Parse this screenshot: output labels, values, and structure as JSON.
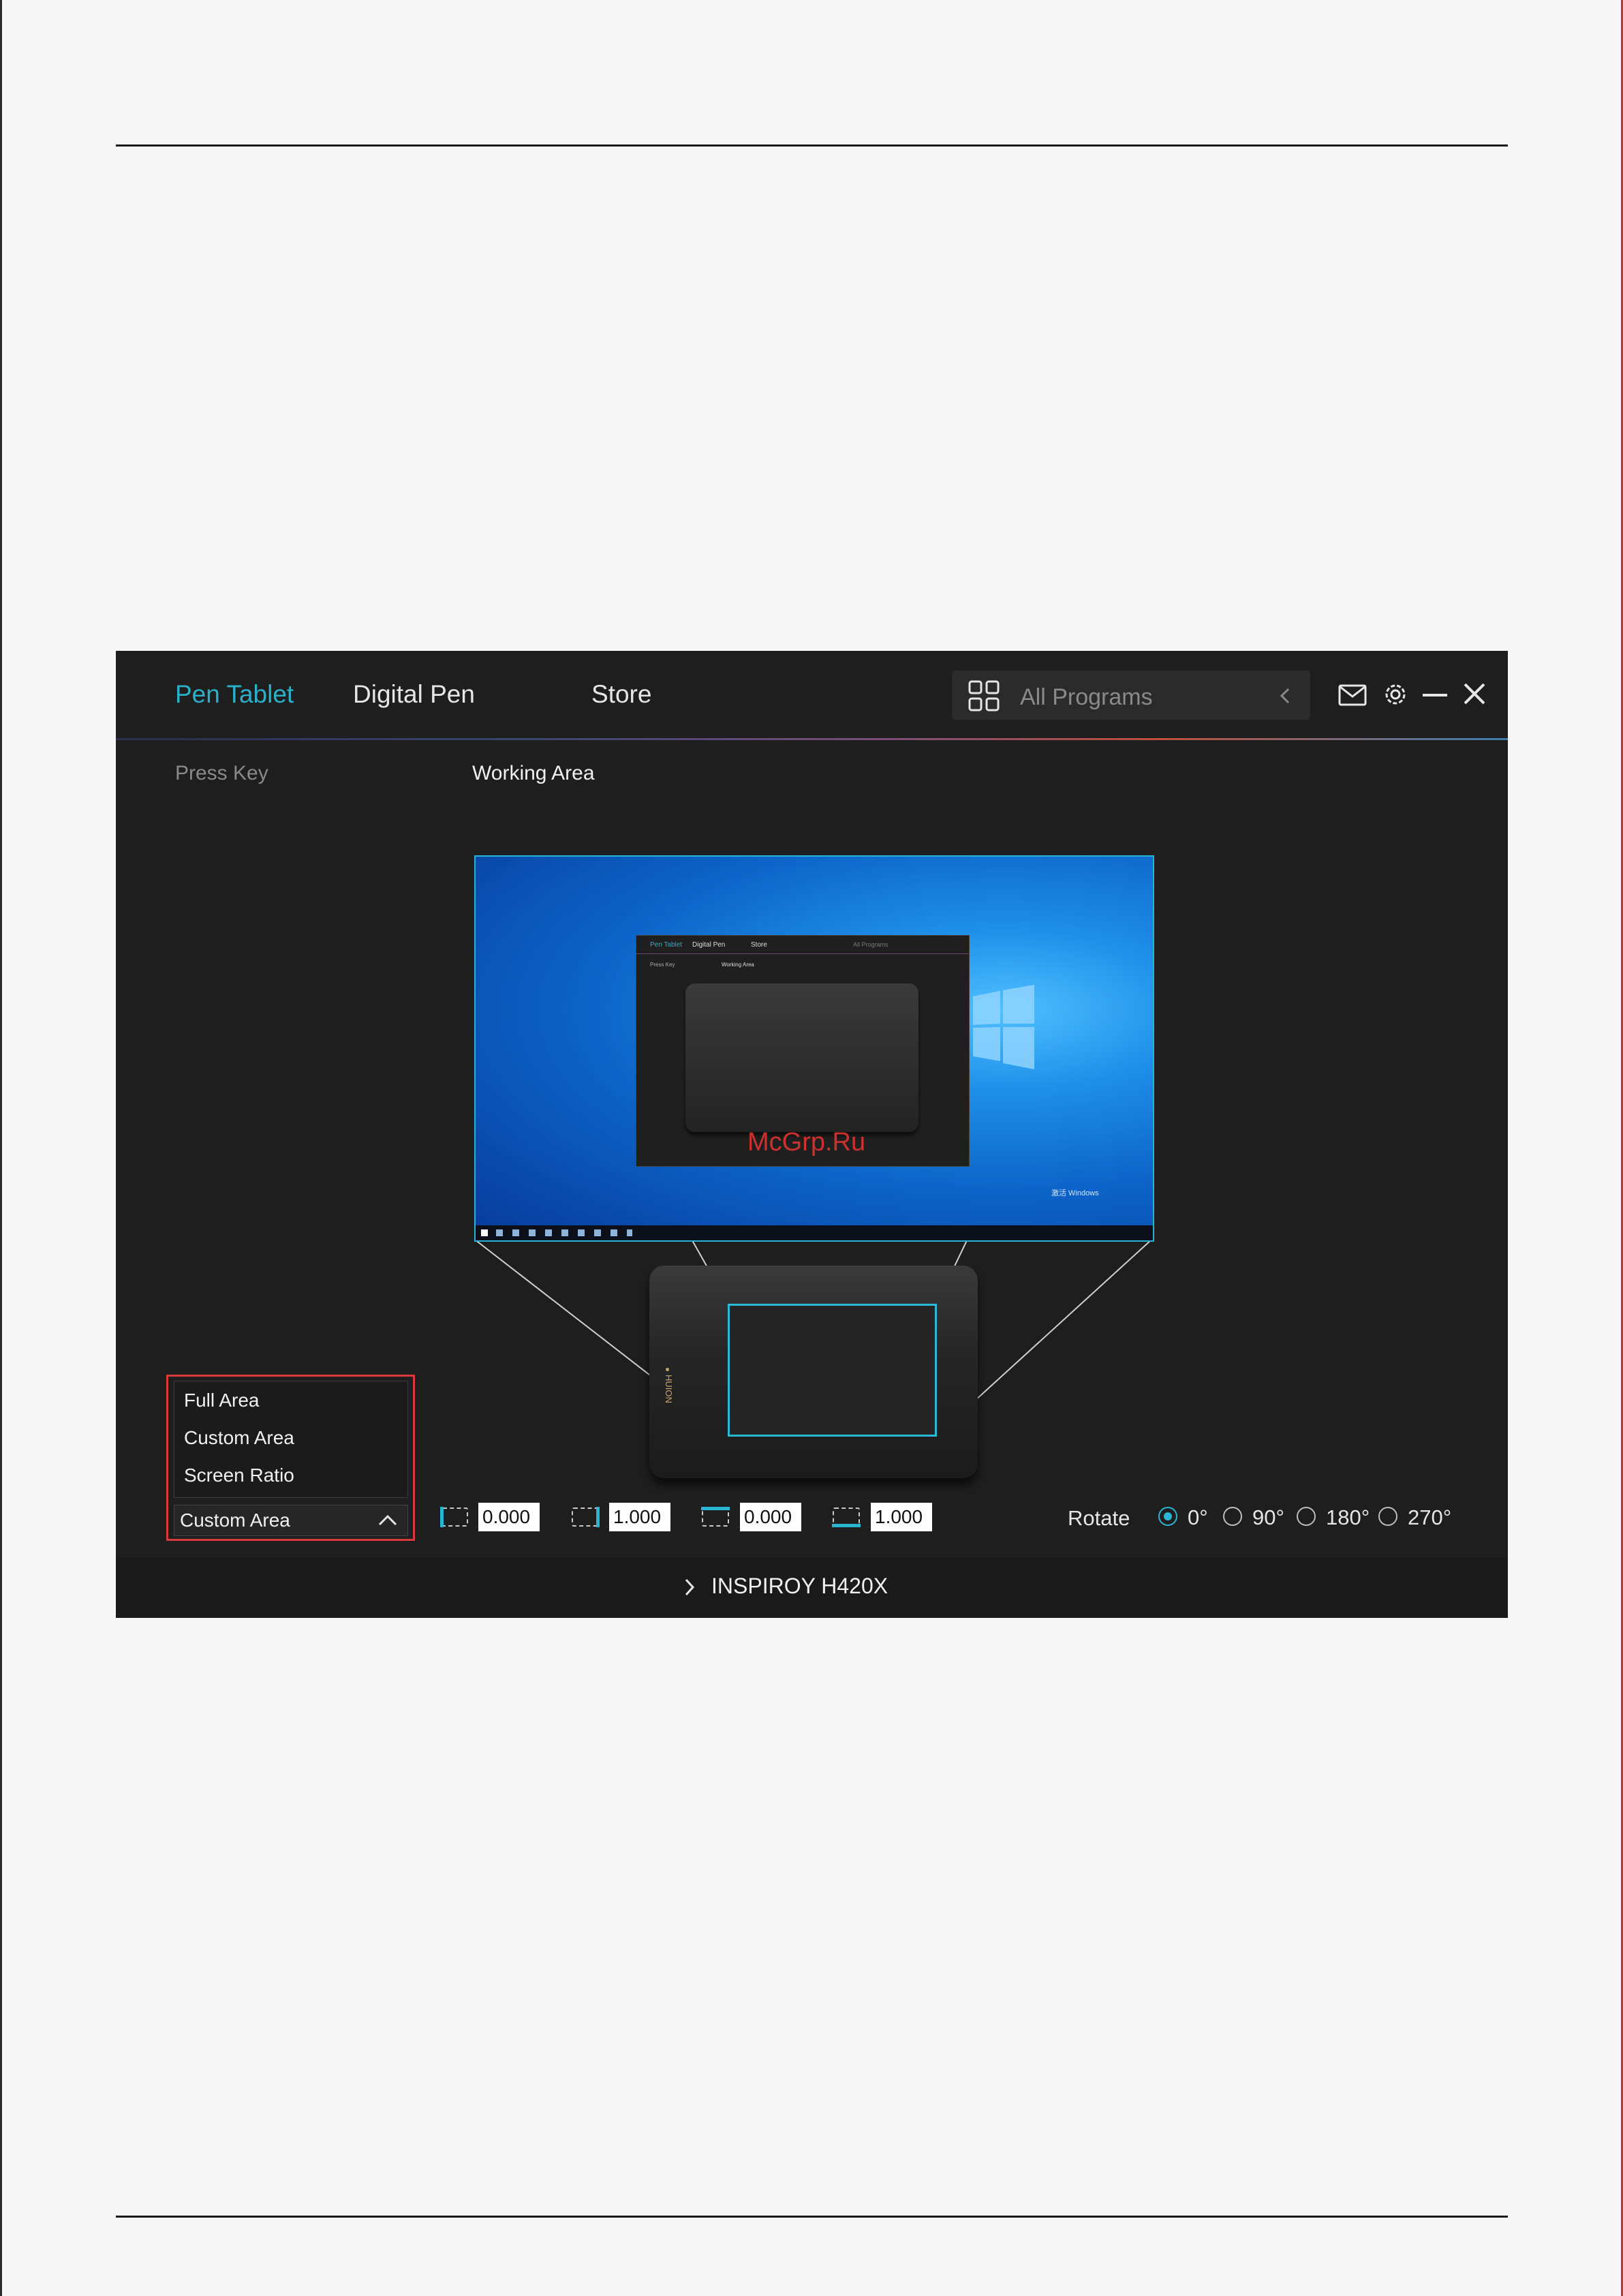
{
  "nav": {
    "tabs": [
      "Pen Tablet",
      "Digital Pen",
      "Store"
    ],
    "active_tab": "Pen Tablet",
    "program_select": "All Programs",
    "accent_color": "#2ab0c8"
  },
  "header_icons": [
    "grid-icon",
    "chevron-left-icon",
    "mail-icon",
    "gear-icon",
    "minimize-icon",
    "close-icon"
  ],
  "subtabs": {
    "press_key": "Press Key",
    "working_area": "Working Area"
  },
  "preview": {
    "mini_app": {
      "tab1": "Pen Tablet",
      "tab2": "Digital Pen",
      "tab3": "Store",
      "programs": "All Programs",
      "subtab1": "Press Key",
      "subtab2": "Working Area"
    },
    "desktop_activation": "激活 Windows",
    "tablet_brand": "HUION"
  },
  "area_dropdown": {
    "options": [
      "Full Area",
      "Custom Area",
      "Screen Ratio"
    ],
    "selected": "Custom Area"
  },
  "coordinates": [
    "0.000",
    "1.000",
    "0.000",
    "1.000"
  ],
  "rotate": {
    "label": "Rotate",
    "options": [
      "0°",
      "90°",
      "180°",
      "270°"
    ],
    "selected": "0°"
  },
  "footer": {
    "device": "INSPIROY H420X"
  },
  "watermark": "McGrp.Ru"
}
